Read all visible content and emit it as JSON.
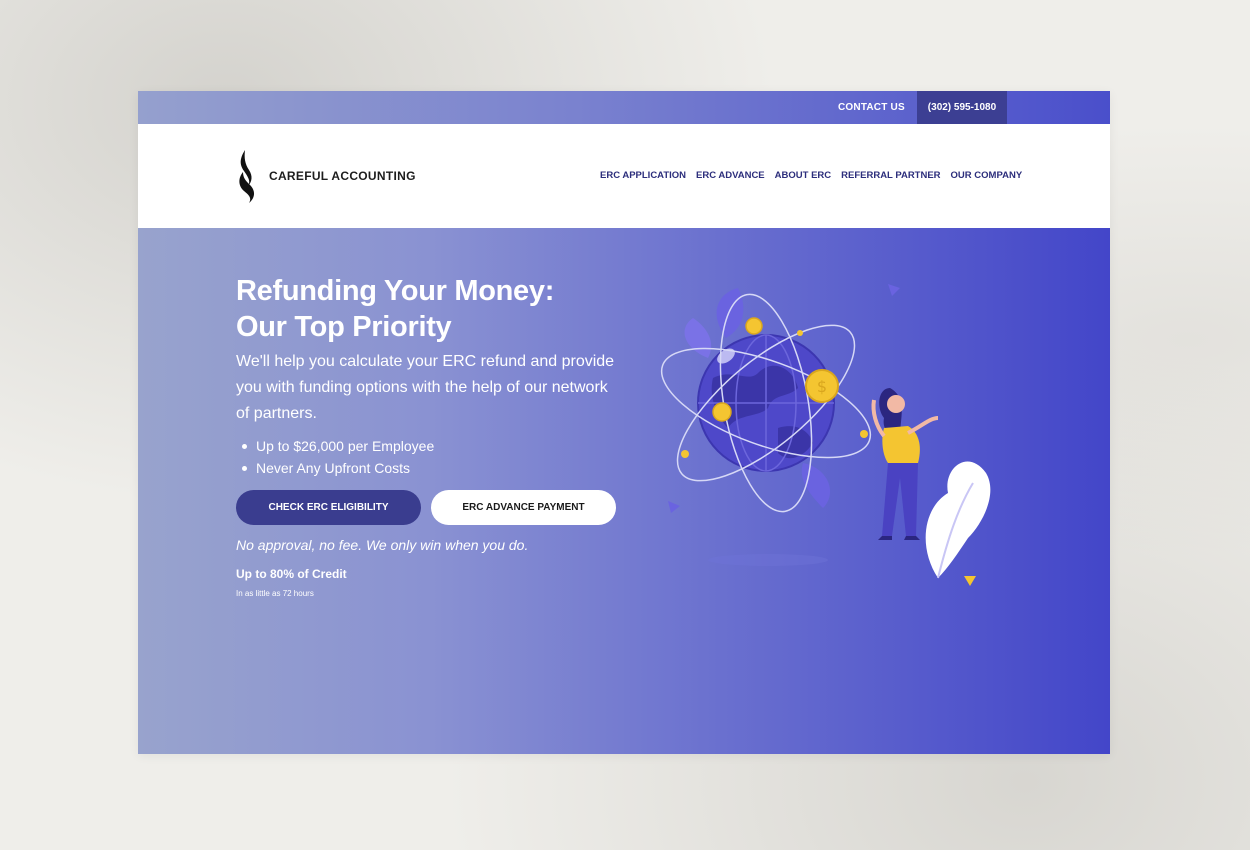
{
  "topbar": {
    "contact_label": "CONTACT US",
    "phone": "(302) 595-1080"
  },
  "brand": {
    "name": "CAREFUL ACCOUNTING"
  },
  "nav": {
    "items": [
      "ERC APPLICATION",
      "ERC ADVANCE",
      "ABOUT ERC",
      "REFERRAL PARTNER",
      "OUR COMPANY"
    ]
  },
  "hero": {
    "headline_line1": "Refunding Your Money:",
    "headline_line2": "Our Top Priority",
    "subtext": "We'll help you calculate your ERC refund and provide you with funding options with the help of our network of partners.",
    "bullets": [
      "Up to $26,000 per Employee",
      "Never Any Upfront Costs"
    ],
    "primary_button": "CHECK ERC ELIGIBILITY",
    "secondary_button": "ERC ADVANCE PAYMENT",
    "tagline": "No approval, no fee. We only win when you do.",
    "credit_title": "Up to 80% of Credit",
    "credit_sub": "In as little as 72 hours"
  },
  "colors": {
    "hero_start": "#98a3cd",
    "hero_end": "#4346c9",
    "primary_button": "#3a3d8f",
    "nav_text": "#2c2e7c",
    "accent_yellow": "#f4c531"
  }
}
